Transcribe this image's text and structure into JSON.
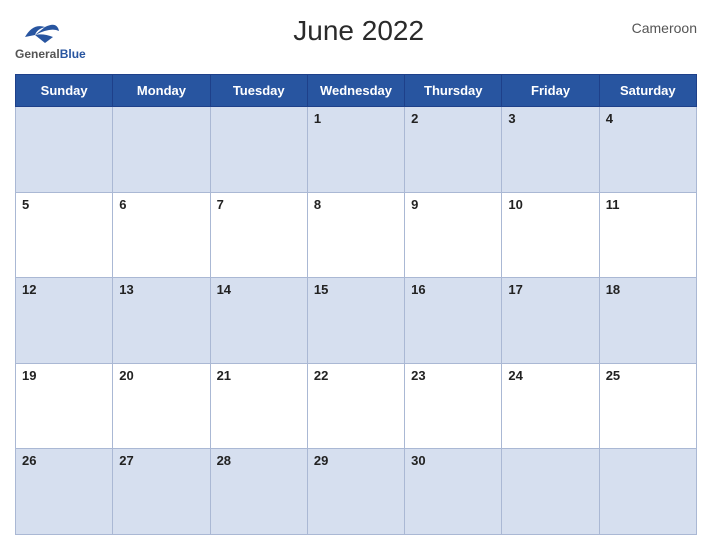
{
  "header": {
    "logo_general": "General",
    "logo_blue": "Blue",
    "title": "June 2022",
    "country": "Cameroon"
  },
  "days_of_week": [
    "Sunday",
    "Monday",
    "Tuesday",
    "Wednesday",
    "Thursday",
    "Friday",
    "Saturday"
  ],
  "weeks": [
    [
      null,
      null,
      null,
      1,
      2,
      3,
      4
    ],
    [
      5,
      6,
      7,
      8,
      9,
      10,
      11
    ],
    [
      12,
      13,
      14,
      15,
      16,
      17,
      18
    ],
    [
      19,
      20,
      21,
      22,
      23,
      24,
      25
    ],
    [
      26,
      27,
      28,
      29,
      30,
      null,
      null
    ]
  ]
}
